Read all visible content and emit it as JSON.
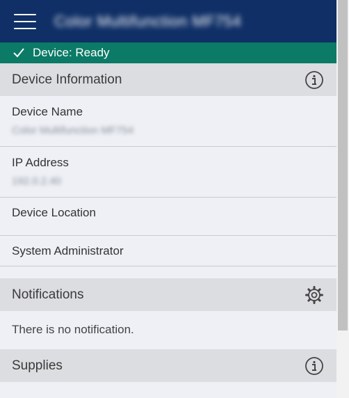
{
  "header": {
    "title": "Color Multifunction MF754"
  },
  "status": {
    "text": "Device: Ready"
  },
  "sections": {
    "device_info": {
      "title": "Device Information",
      "fields": [
        {
          "label": "Device Name",
          "value": "Color Multifunction MF754"
        },
        {
          "label": "IP Address",
          "value": "192.0.2.40"
        },
        {
          "label": "Device Location",
          "value": ""
        },
        {
          "label": "System Administrator",
          "value": ""
        }
      ]
    },
    "notifications": {
      "title": "Notifications",
      "message": "There is no notification."
    },
    "supplies": {
      "title": "Supplies"
    }
  },
  "icons": {
    "menu": "hamburger-icon",
    "status": "check-icon",
    "info": "info-icon",
    "settings": "gear-icon"
  },
  "colors": {
    "header_bg": "#0f2f66",
    "status_bg": "#0b7a66",
    "section_bg": "#dcdde1",
    "body_bg": "#eef0f5"
  }
}
